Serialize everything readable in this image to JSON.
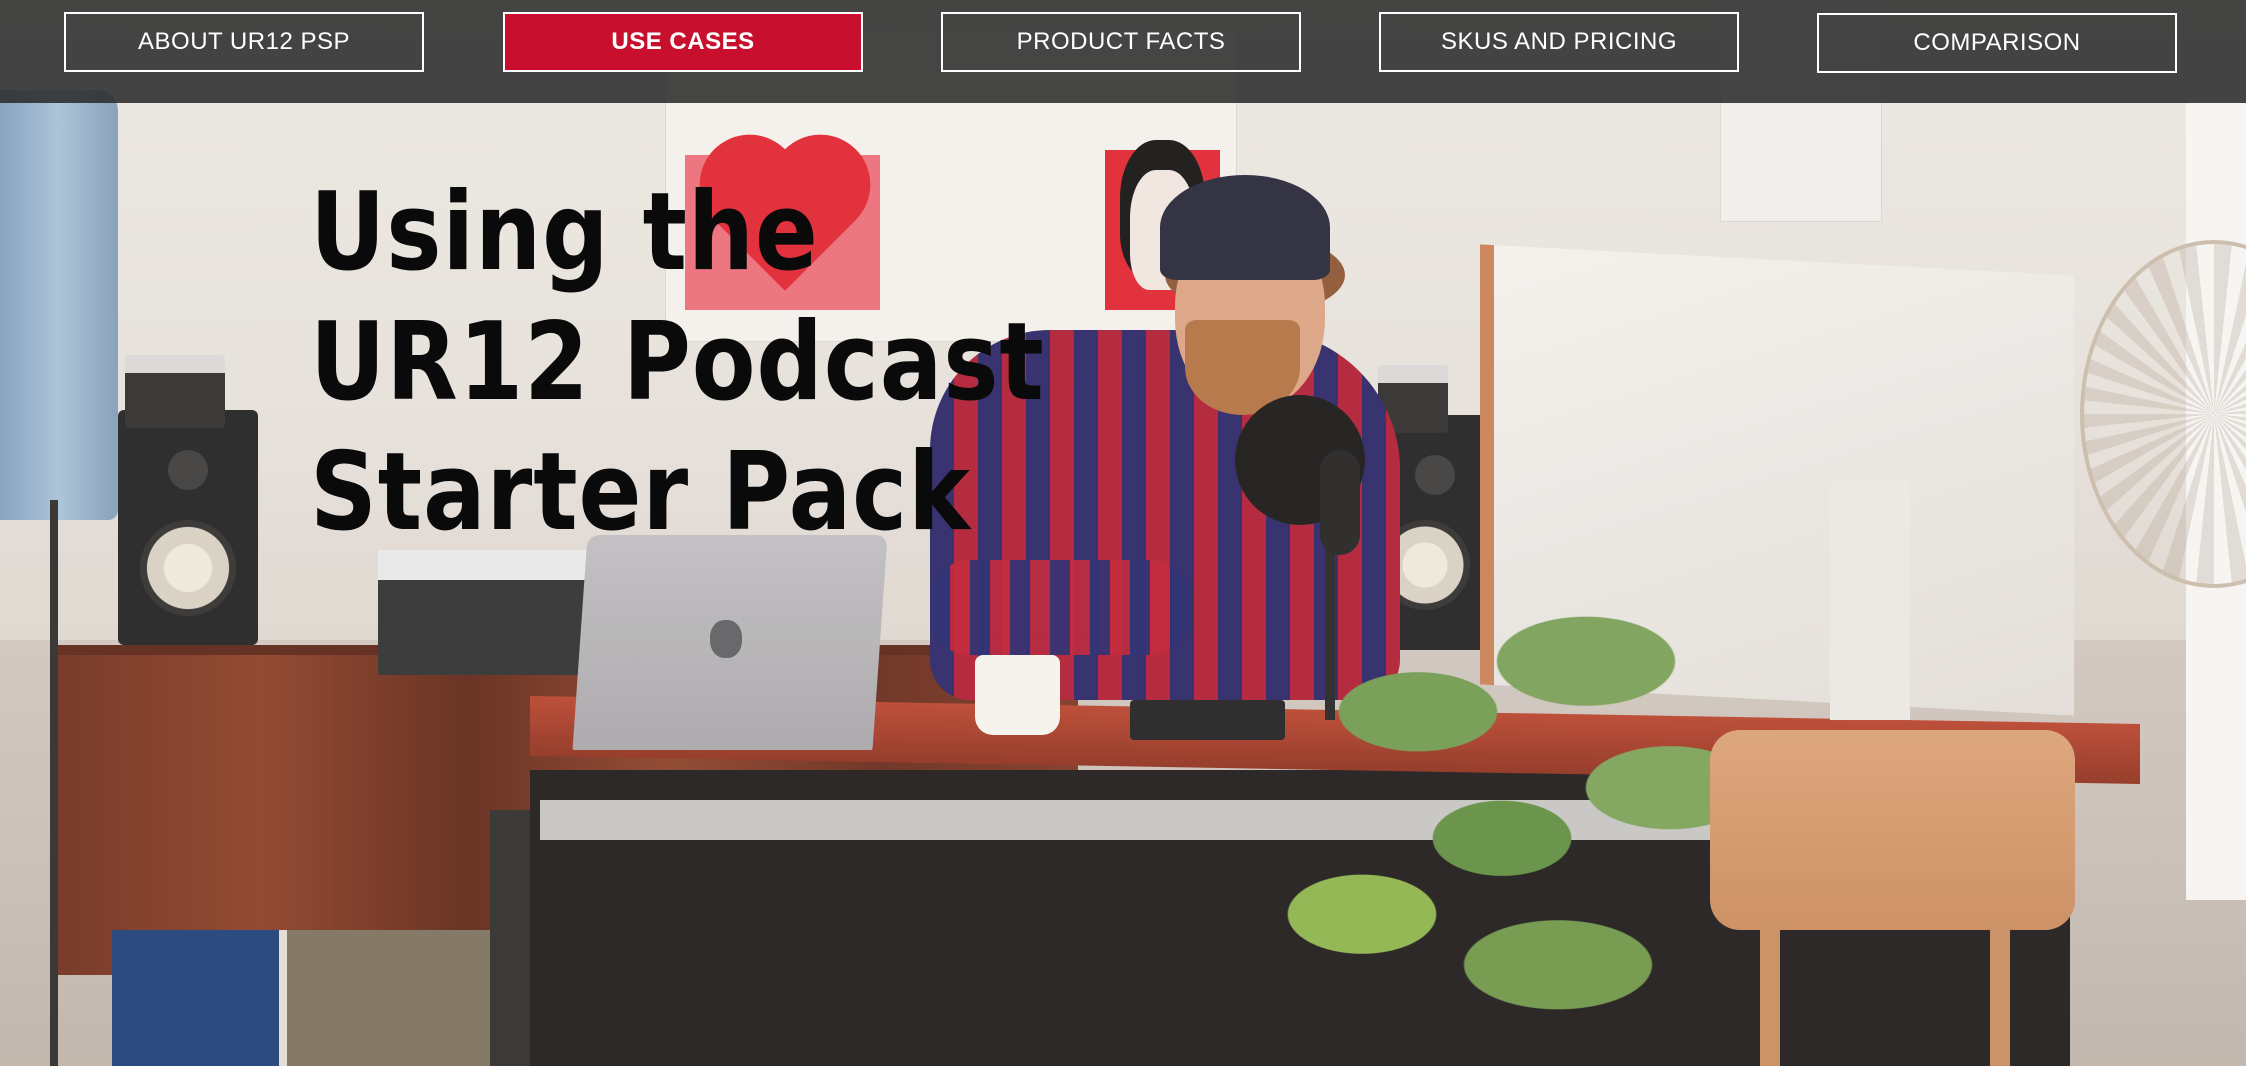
{
  "nav": {
    "items": [
      {
        "label": "ABOUT UR12 PSP",
        "active": false
      },
      {
        "label": "USE CASES",
        "active": true
      },
      {
        "label": "PRODUCT FACTS",
        "active": false
      },
      {
        "label": "SKUS AND PRICING",
        "active": false
      },
      {
        "label": "COMPARISON",
        "active": false
      }
    ]
  },
  "hero": {
    "title_lines": [
      "Using the",
      "UR12 Podcast",
      "Starter Pack"
    ]
  },
  "colors": {
    "accent": "#c8102e",
    "navbar_bg": "#2c2c2c",
    "headline": "#0a0a0a"
  }
}
